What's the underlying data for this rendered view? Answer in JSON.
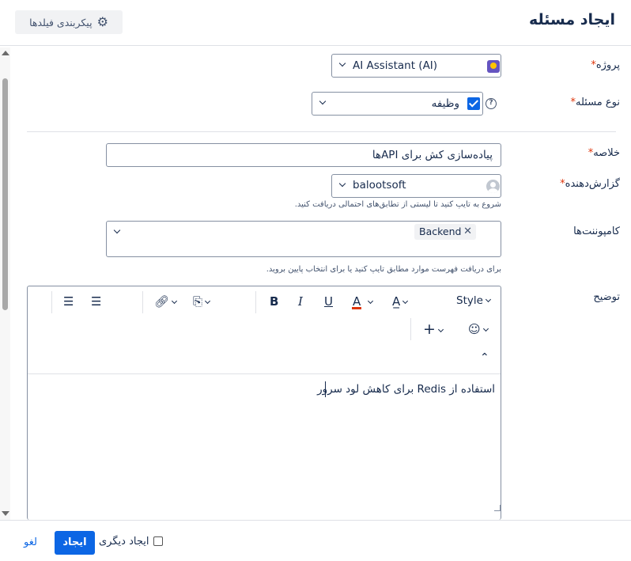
{
  "header": {
    "title": "ایجاد مسئله",
    "configure_fields_label": "پیکربندی فیلدها"
  },
  "fields": {
    "project": {
      "label": "پروژه",
      "value": "AI Assistant (AI)"
    },
    "issue_type": {
      "label": "نوع مسئله",
      "value": "وظیفه"
    },
    "summary": {
      "label": "خلاصه",
      "value": "پیاده‌سازی کش برای APIها"
    },
    "reporter": {
      "label": "گزارش‌دهنده",
      "value": "balootsoft",
      "hint": "شروع به تایپ کنید تا لیستی از تطابق‌های احتمالی دریافت کنید."
    },
    "components": {
      "label": "کامپوننت‌ها",
      "tags": [
        "Backend"
      ],
      "hint": "برای دریافت فهرست موارد مطابق تایپ کنید یا برای انتخاب پایین بروید."
    },
    "description": {
      "label": "توضیح",
      "value": "استفاده از Redis برای کاهش لود سرور",
      "toolbar": {
        "style_label": "Style",
        "bold": "B",
        "italic": "I",
        "underline": "U",
        "text_color": "A",
        "add": "+"
      }
    }
  },
  "footer": {
    "create_label": "ایجاد",
    "create_another_label": "ایجاد دیگری",
    "cancel_label": "لغو"
  },
  "colors": {
    "primary": "#0c66e4",
    "required": "#de350b",
    "text_color_underline": "#de350b"
  }
}
